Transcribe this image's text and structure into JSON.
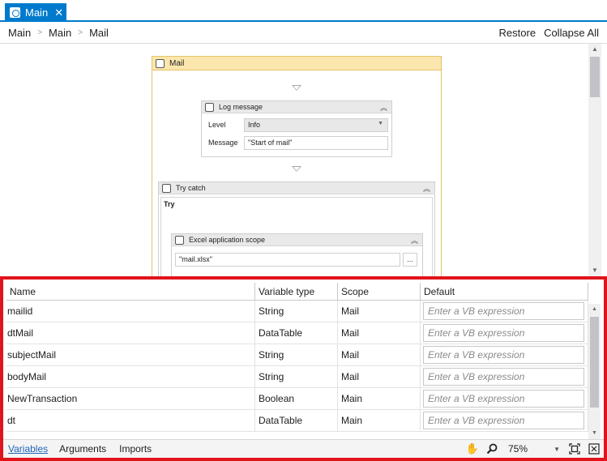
{
  "tab": {
    "title": "Main",
    "close": "✕"
  },
  "breadcrumb": {
    "items": [
      "Main",
      "Main",
      "Mail"
    ],
    "restore": "Restore",
    "collapse_all": "Collapse All"
  },
  "designer": {
    "sequence_title": "Mail",
    "log_message": {
      "title": "Log message",
      "level_label": "Level",
      "level_value": "Info",
      "message_label": "Message",
      "message_value": "\"Start of mail\""
    },
    "try_catch": {
      "title": "Try catch",
      "try_label": "Try"
    },
    "excel_scope": {
      "title": "Excel application scope",
      "path_value": "\"mail.xlsx\"",
      "browse_label": "..."
    }
  },
  "variables": {
    "columns": [
      "Name",
      "Variable type",
      "Scope",
      "Default"
    ],
    "default_placeholder": "Enter a VB expression",
    "rows": [
      {
        "name": "mailid",
        "type": "String",
        "scope": "Mail"
      },
      {
        "name": "dtMail",
        "type": "DataTable",
        "scope": "Mail"
      },
      {
        "name": "subjectMail",
        "type": "String",
        "scope": "Mail"
      },
      {
        "name": "bodyMail",
        "type": "String",
        "scope": "Mail"
      },
      {
        "name": "NewTransaction",
        "type": "Boolean",
        "scope": "Main"
      },
      {
        "name": "dt",
        "type": "DataTable",
        "scope": "Main"
      }
    ]
  },
  "bottom": {
    "tabs": [
      "Variables",
      "Arguments",
      "Imports"
    ],
    "zoom": "75%",
    "icons": [
      "hand-pan-icon",
      "zoom-search-icon",
      "fit-to-screen-icon",
      "overview-icon"
    ]
  },
  "colors": {
    "accent": "#007acc",
    "highlight_border": "#e0141b",
    "sequence_header": "#fbe7ad"
  }
}
